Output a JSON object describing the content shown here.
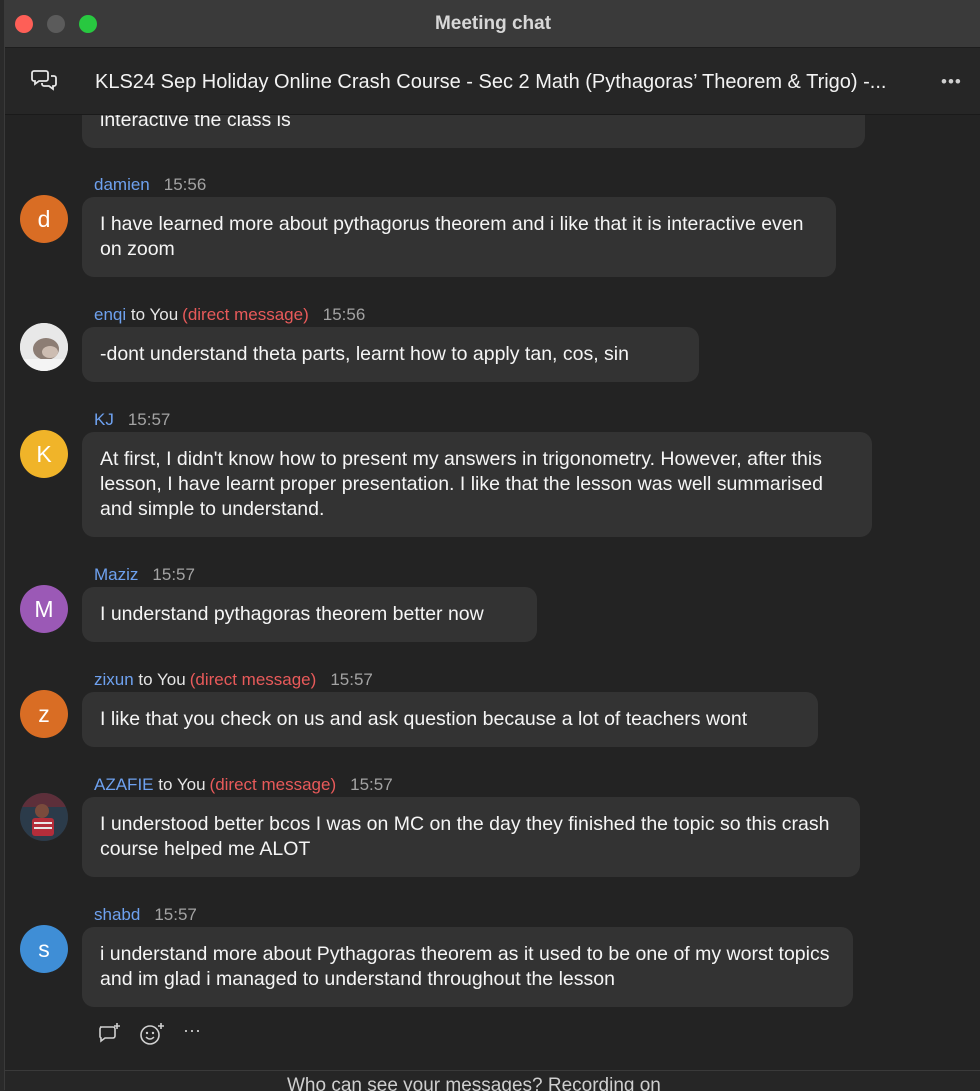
{
  "window": {
    "title": "Meeting chat"
  },
  "header": {
    "chat_title": "KLS24 Sep Holiday Online Crash Course - Sec 2 Math (Pythagoras’ Theorem & Trigo) -...",
    "more": "•••"
  },
  "messages": [
    {
      "avatar": "",
      "name": "",
      "to": "",
      "dm": "",
      "time": "",
      "text": "interactive the class is"
    },
    {
      "avatar": "d",
      "avatar_color": "#d96d24",
      "name": "damien",
      "to": "",
      "dm": "",
      "time": "15:56",
      "text": "I have learned more about pythagorus theorem and i like that it is interactive even on zoom"
    },
    {
      "avatar": "",
      "avatar_color": "#cfcfcf",
      "name": "enqi",
      "to": "to You",
      "dm": "(direct message)",
      "time": "15:56",
      "text": "-dont understand theta parts, learnt how to apply tan, cos, sin"
    },
    {
      "avatar": "K",
      "avatar_color": "#f0b429",
      "name": "KJ",
      "to": "",
      "dm": "",
      "time": "15:57",
      "text": "At first, I didn't know how to present my answers in trigonometry. However, after this lesson, I have learnt proper presentation. I like that the lesson was well summarised and simple to understand."
    },
    {
      "avatar": "M",
      "avatar_color": "#9b59b6",
      "name": "Maziz",
      "to": "",
      "dm": "",
      "time": "15:57",
      "text": "I understand pythagoras theorem better now"
    },
    {
      "avatar": "z",
      "avatar_color": "#d96d24",
      "name": "zixun",
      "to": "to You",
      "dm": "(direct message)",
      "time": "15:57",
      "text": "I like that you check on us and ask question because a lot of teachers wont"
    },
    {
      "avatar": "",
      "avatar_color": "#3b2a2a",
      "name": "AZAFIE",
      "to": "to You",
      "dm": "(direct message)",
      "time": "15:57",
      "text": "I understood better bcos I was on MC on the day they finished the topic so this crash course helped me ALOT"
    },
    {
      "avatar": "s",
      "avatar_color": "#3f8ed6",
      "name": "shabd",
      "to": "",
      "dm": "",
      "time": "15:57",
      "text": "i understand more about Pythagoras theorem as it used to be one of my worst topics and im glad i managed to understand throughout the lesson"
    }
  ],
  "reactions": {
    "reply_icon": "reply-icon",
    "emoji_icon": "emoji-add-icon",
    "more": "···"
  },
  "footer": {
    "text": "Who can see your messages? Recording on"
  },
  "colors": {
    "accent_name": "#6ea1ef",
    "direct_message": "#e85a5a",
    "bubble": "#333333"
  }
}
